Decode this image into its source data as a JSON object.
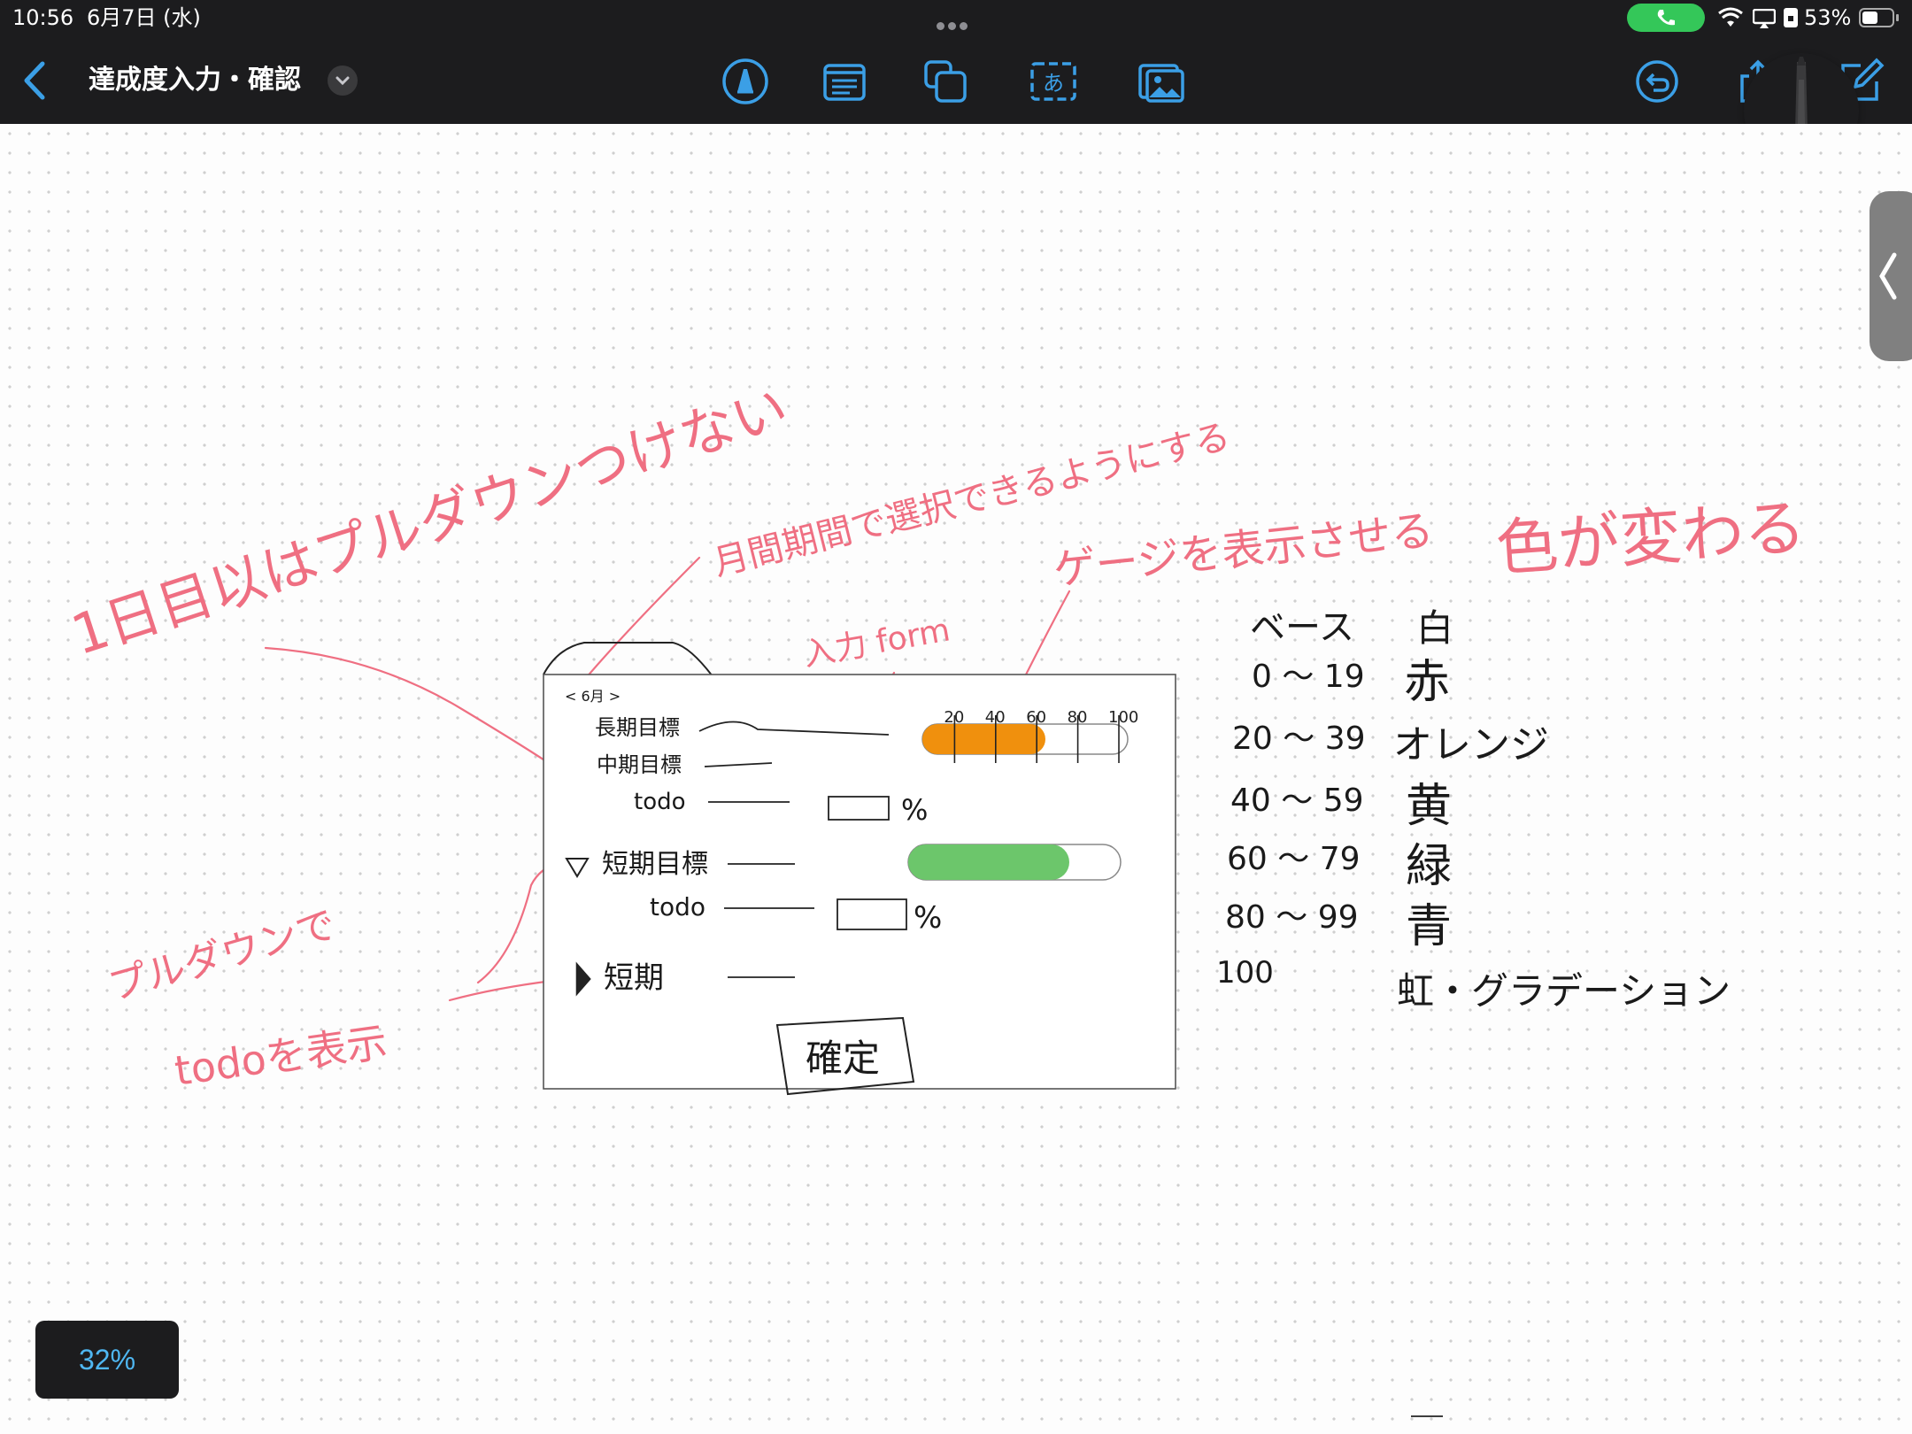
{
  "status_bar": {
    "time": "10:56",
    "date": "6月7日 (水)",
    "battery": "53%",
    "battery_level": 0.53
  },
  "toolbar": {
    "title": "達成度入力・確認",
    "tools": [
      "pen-tool-icon",
      "text-box-icon",
      "shapes-icon",
      "text-recognition-icon",
      "image-icon"
    ],
    "right_tools": [
      "undo-icon",
      "share-icon",
      "new-note-icon"
    ],
    "pencil_label": "A"
  },
  "zoom": "32%",
  "sketch": {
    "wireframe": {
      "month": "< 6月 >",
      "long_goal": "長期目標",
      "mid_goal": "中期目標",
      "todo_1": "todo",
      "percent_1": "%",
      "short_mid": "短期目標",
      "todo_2": "todo",
      "percent_2": "%",
      "short": "短期",
      "confirm": "確定",
      "gauge_ticks": [
        "20",
        "40",
        "60",
        "80",
        "100"
      ],
      "gauge_1_level": 0.6,
      "gauge_2_level": 0.76
    },
    "legend": {
      "header_left": "ベース",
      "header_right": "白",
      "rows": [
        {
          "range": "0 〜 19",
          "color_name": "赤"
        },
        {
          "range": "20 〜 39",
          "color_name": "オレンジ"
        },
        {
          "range": "40 〜 59",
          "color_name": "黄"
        },
        {
          "range": "60 〜 79",
          "color_name": "緑"
        },
        {
          "range": "80 〜 99",
          "color_name": "青"
        },
        {
          "range": "100",
          "color_name": "虹・グラデーション"
        }
      ]
    },
    "notes": {
      "note_top": "1日目以はプルダウンつけない",
      "note_period": "月間期間で選択できるようにする",
      "note_input": "入力 form",
      "note_gauge": "ゲージを表示させる",
      "note_color": "色が変わる",
      "note_pulldown": "プルダウンで",
      "note_todo": "todoを表示"
    }
  },
  "colors": {
    "toolbar_bg": "#1c1c1e",
    "accent": "#3b9fe6",
    "gauge_orange": "#f0900d",
    "gauge_green": "#6cc66b",
    "ink_red": "#ef6f82",
    "ink_black": "#1a1a1a"
  }
}
